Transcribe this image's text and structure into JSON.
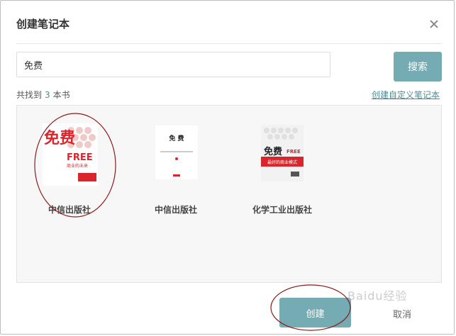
{
  "dialog": {
    "title": "创建笔记本",
    "close_icon": "close-icon"
  },
  "search": {
    "value": "免费",
    "button_label": "搜索"
  },
  "results_info": {
    "prefix": "共找到",
    "count": "3",
    "suffix": "本书",
    "custom_link": "创建自定义笔记本"
  },
  "books": [
    {
      "publisher": "中信出版社",
      "cover_title": "免费",
      "cover_sub": "FREE",
      "cover_line": "商业的未来"
    },
    {
      "publisher": "中信出版社",
      "cover_title": "免 费"
    },
    {
      "publisher": "化学工业出版社",
      "cover_title": "免费",
      "cover_sub": "FREE",
      "cover_line": "最好的商业模式"
    }
  ],
  "footer": {
    "create_label": "创建",
    "cancel_label": "取消"
  },
  "colors": {
    "accent": "#75abb2",
    "link": "#4d8a93",
    "annotation": "#8b1a1a"
  },
  "watermark": "Baidu经验"
}
